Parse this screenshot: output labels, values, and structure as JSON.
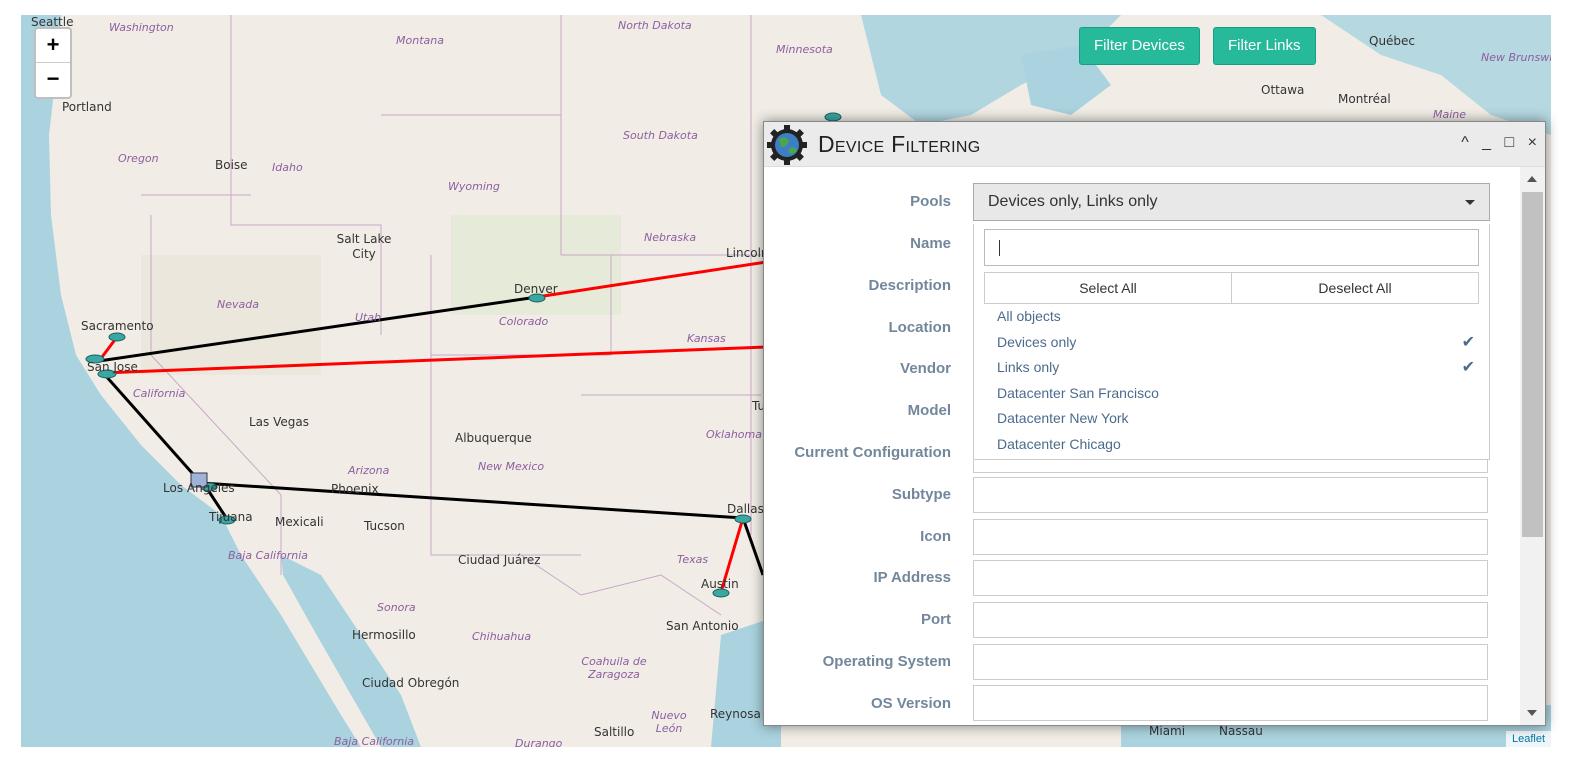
{
  "map": {
    "zoom_in": "+",
    "zoom_out": "−",
    "attribution": "Leaflet",
    "buttons": {
      "filter_devices": "Filter Devices",
      "filter_links": "Filter Links"
    },
    "cities": {
      "seattle": "Seattle",
      "portland": "Portland",
      "boise": "Boise",
      "salt_lake": "Salt Lake City",
      "sacramento": "Sacramento",
      "san_jose": "San Jose",
      "las_vegas": "Las Vegas",
      "denver": "Denver",
      "lincoln": "Lincoln",
      "albuquerque": "Albuquerque",
      "phoenix": "Phoenix",
      "los_angeles": "Los Angeles",
      "tijuana": "Tijuana",
      "mexicali": "Mexicali",
      "tucson": "Tucson",
      "ciudad_juarez": "Ciudad Juárez",
      "dallas": "Dallas",
      "austin": "Austin",
      "san_antonio": "San Antonio",
      "hermosillo": "Hermosillo",
      "ciudad_obregon": "Ciudad Obregón",
      "saltillo": "Saltillo",
      "reynosa": "Reynosa",
      "ottawa": "Ottawa",
      "montreal": "Montréal",
      "quebec": "Québec",
      "miami": "Miami",
      "nassau": "Nassau",
      "tulsa": "Tu"
    },
    "regions": {
      "washington": "Washington",
      "montana": "Montana",
      "north_dakota": "North Dakota",
      "minnesota": "Minnesota",
      "oregon": "Oregon",
      "idaho": "Idaho",
      "south_dakota": "South Dakota",
      "wyoming": "Wyoming",
      "nebraska": "Nebraska",
      "nevada": "Nevada",
      "utah": "Utah",
      "colorado": "Colorado",
      "kansas": "Kansas",
      "california": "California",
      "oklahoma": "Oklahoma",
      "arizona": "Arizona",
      "new_mexico": "New Mexico",
      "texas": "Texas",
      "baja_california": "Baja California",
      "sonora": "Sonora",
      "chihuahua": "Chihuahua",
      "coahuila": "Coahuila de Zaragoza",
      "nuevo_leon": "Nuevo León",
      "baja_california_sur": "Baja California",
      "durango": "Durango",
      "new_brunswick": "New Brunswic",
      "maine": "Maine"
    }
  },
  "panel": {
    "title": "Device Filtering",
    "controls": {
      "collapse": "^",
      "minimize": "_",
      "maximize": "□",
      "close": "×"
    },
    "pools": {
      "label": "Pools",
      "value": "Devices only, Links only",
      "select_all": "Select All",
      "deselect_all": "Deselect All",
      "options": [
        {
          "label": "All objects",
          "checked": false
        },
        {
          "label": "Devices only",
          "checked": true
        },
        {
          "label": "Links only",
          "checked": true
        },
        {
          "label": "Datacenter San Francisco",
          "checked": false
        },
        {
          "label": "Datacenter New York",
          "checked": false
        },
        {
          "label": "Datacenter Chicago",
          "checked": false
        }
      ]
    },
    "fields": {
      "name": "Name",
      "description": "Description",
      "location": "Location",
      "vendor": "Vendor",
      "model": "Model",
      "current_configuration": "Current Configuration",
      "subtype": "Subtype",
      "icon": "Icon",
      "ip_address": "IP Address",
      "port": "Port",
      "operating_system": "Operating System",
      "os_version": "OS Version"
    }
  }
}
